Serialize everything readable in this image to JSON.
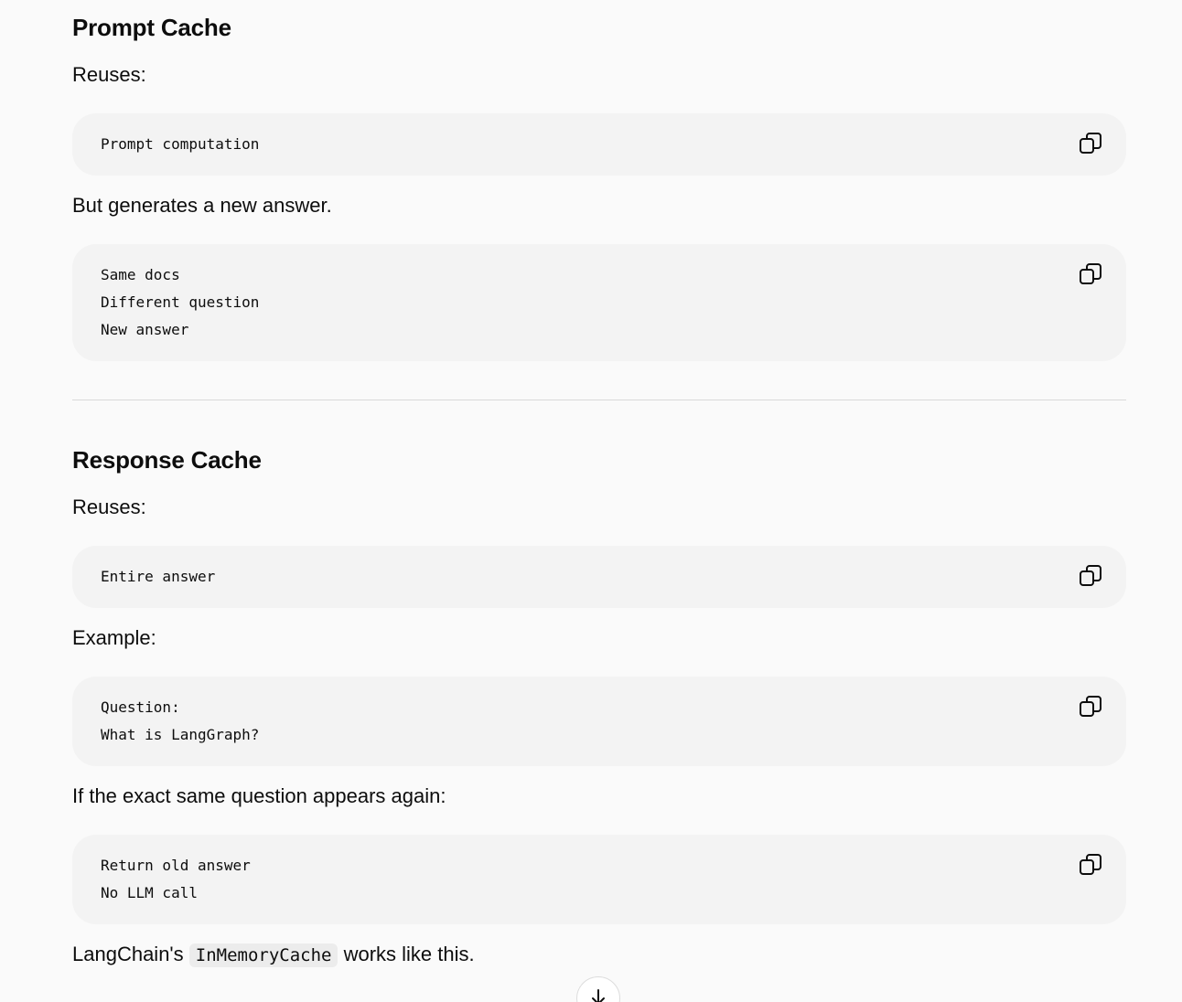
{
  "sections": [
    {
      "heading": "Prompt Cache",
      "reuses_label": "Reuses:",
      "code1": [
        "Prompt computation"
      ],
      "after_text": "But generates a new answer.",
      "code2": [
        "Same docs",
        "Different question",
        "New answer"
      ]
    },
    {
      "heading": "Response Cache",
      "reuses_label": "Reuses:",
      "code1": [
        "Entire answer"
      ],
      "example_label": "Example:",
      "code2": [
        "Question:",
        "What is LangGraph?"
      ],
      "repeat_text": "If the exact same question appears again:",
      "code3": [
        "Return old answer",
        "No LLM call"
      ],
      "footer_before": "LangChain's ",
      "footer_code": "InMemoryCache",
      "footer_after": " works like this."
    }
  ],
  "icons": {
    "copy": "copy-icon",
    "scroll": "arrow-down-icon"
  }
}
